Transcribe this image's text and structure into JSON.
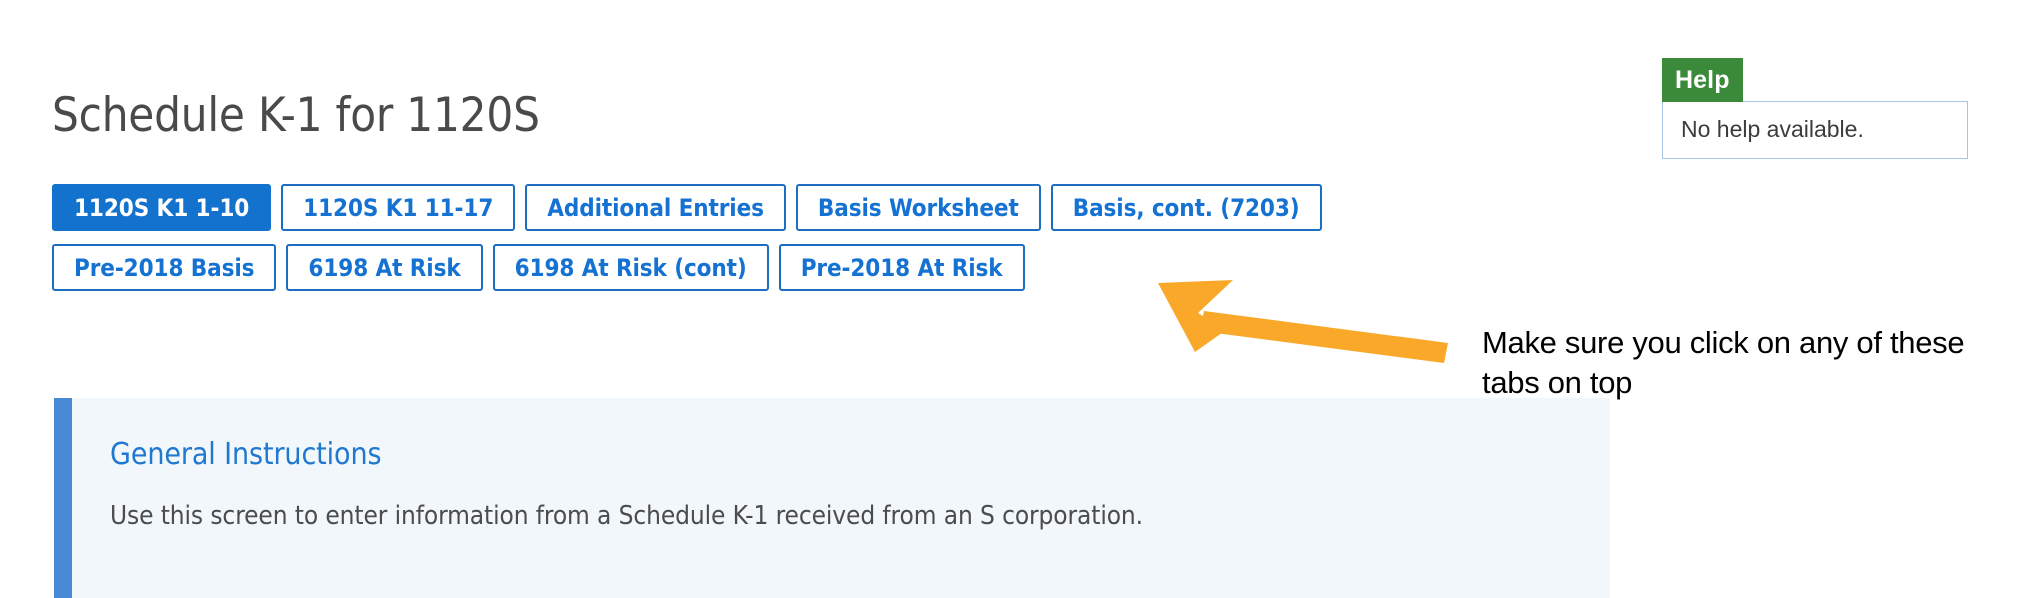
{
  "page": {
    "title": "Schedule K-1 for 1120S"
  },
  "tabs": {
    "rows": [
      [
        {
          "label": "1120S K1 1-10",
          "active": true
        },
        {
          "label": "1120S K1 11-17",
          "active": false
        },
        {
          "label": "Additional Entries",
          "active": false
        },
        {
          "label": "Basis Worksheet",
          "active": false
        },
        {
          "label": "Basis, cont. (7203)",
          "active": false
        }
      ],
      [
        {
          "label": "Pre-2018 Basis",
          "active": false
        },
        {
          "label": "6198 At Risk",
          "active": false
        },
        {
          "label": "6198 At Risk (cont)",
          "active": false
        },
        {
          "label": "Pre-2018 At Risk",
          "active": false
        }
      ]
    ]
  },
  "help": {
    "tab_label": "Help",
    "body_text": "No help available."
  },
  "instructions": {
    "heading": "General Instructions",
    "text": "Use this screen to enter information from a Schedule K-1 received from an S corporation."
  },
  "annotation": {
    "text": "Make sure you click on any of these tabs on top",
    "arrow_color": "#f9a829"
  },
  "colors": {
    "tab_active_bg": "#1272ce",
    "tab_border": "#1b6ec2",
    "tab_text": "#1572d3",
    "help_green": "#3a8a3a",
    "help_border": "#a9c5e6",
    "panel_bg": "#f2f7fb",
    "panel_accent": "#4888d4",
    "heading_blue": "#2079cf",
    "title_gray": "#4a4a4a",
    "annotation_orange": "#f9a829"
  }
}
